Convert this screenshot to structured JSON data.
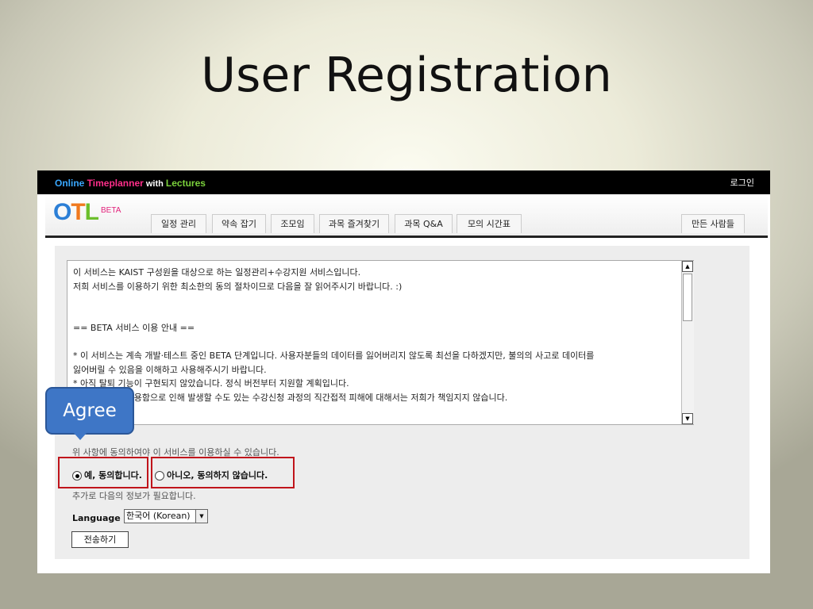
{
  "slide": {
    "title": "User Registration"
  },
  "app": {
    "brand": {
      "part1": "Online ",
      "part2": "Timeplanner",
      "part3": " with ",
      "part4": "Lectures"
    },
    "login_label": "로그인",
    "logo": {
      "letters": [
        "O",
        "T",
        "L"
      ],
      "beta": "BETA"
    },
    "tabs": [
      "일정 관리",
      "약속 잡기",
      "조모임",
      "과목 즐겨찾기",
      "과목 Q&A",
      "모의 시간표"
    ],
    "credits_tab": "만든 사람들"
  },
  "terms": {
    "lines": [
      "이 서비스는 KAIST 구성원을 대상으로 하는 일정관리+수강지원 서비스입니다.",
      "저희 서비스를 이용하기 위한 최소한의 동의 절차이므로 다음을 잘 읽어주시기 바랍니다. :)",
      "",
      "",
      "== BETA 서비스 이용 안내 ==",
      "",
      " * 이 서비스는 계속 개발·테스트 중인 BETA 단계입니다. 사용자분들의 데이터를 잃어버리지 않도록 최선을 다하겠지만, 불의의 사고로 데이터를",
      "잃어버릴 수 있음을 이해하고 사용해주시기 바랍니다.",
      " * 아직 탈퇴 기능이 구현되지 않았습니다. 정식 버전부터 지원할 계획입니다.",
      " * 이 서비스를 사용함으로 인해 발생할 수도 있는 수강신청 과정의 직간접적 피해에 대해서는 저희가 책임지지 않습니다."
    ]
  },
  "form": {
    "notice": "위 사항에 동의하여야 이 서비스를 이용하실 수 있습니다.",
    "agree_label": "예, 동의합니다.",
    "disagree_label": "아니오, 동의하지 않습니다.",
    "agree_selected": true,
    "extra_info": "추가로 다음의 정보가 필요합니다.",
    "language_label": "Language :",
    "language_value": "한국어 (Korean)",
    "submit_label": "전송하기"
  },
  "annotation": {
    "callout_text": "Agree",
    "highlight_color": "#c0141b",
    "callout_color": "#3e76c6"
  }
}
